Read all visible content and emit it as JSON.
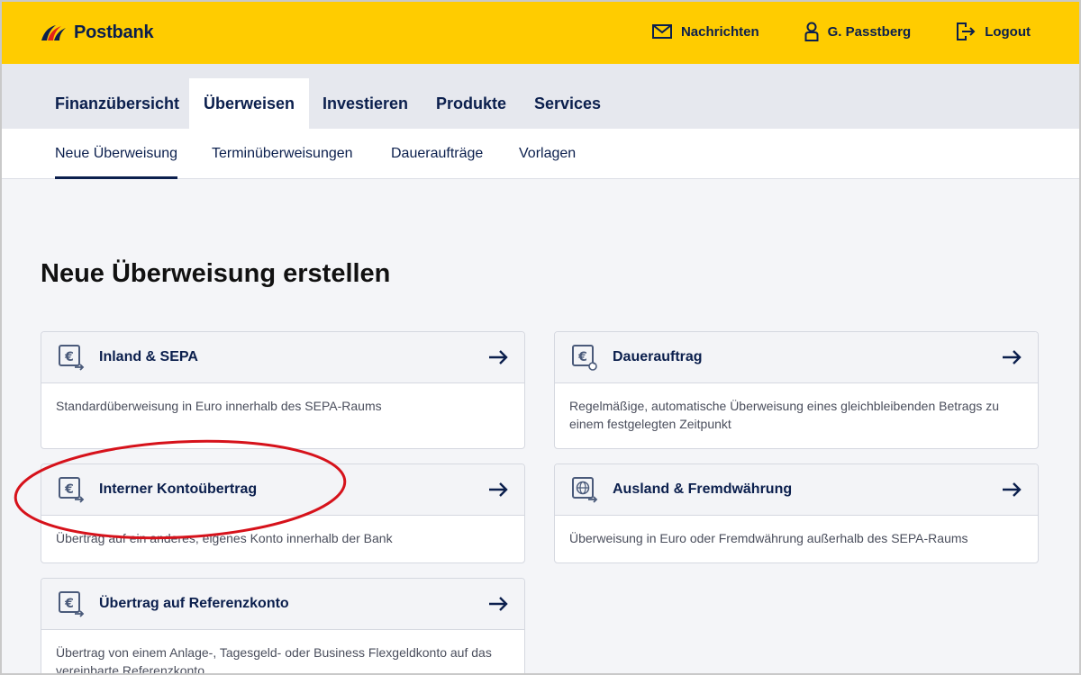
{
  "brand": {
    "name": "Postbank",
    "colors": {
      "yellow": "#ffcc00",
      "navy": "#0b1f4d",
      "highlight": "#d6121b"
    }
  },
  "header": {
    "actions": [
      {
        "label": "Nachrichten",
        "icon": "envelope-icon"
      },
      {
        "label": "G. Passtberg",
        "icon": "user-icon"
      },
      {
        "label": "Logout",
        "icon": "logout-icon"
      }
    ]
  },
  "main_nav": {
    "items": [
      {
        "label": "Finanzübersicht"
      },
      {
        "label": "Überweisen",
        "active": true
      },
      {
        "label": "Investieren"
      },
      {
        "label": "Produkte"
      },
      {
        "label": "Services"
      }
    ]
  },
  "sub_nav": {
    "items": [
      {
        "label": "Neue Überweisung",
        "active": true
      },
      {
        "label": "Terminüberweisungen"
      },
      {
        "label": "Daueraufträge"
      },
      {
        "label": "Vorlagen"
      }
    ]
  },
  "page": {
    "title": "Neue Überweisung erstellen"
  },
  "cards": [
    {
      "title": "Inland & SEPA",
      "icon": "euro-transfer-icon",
      "description": "Standardüberweisung in Euro innerhalb des SEPA-Raums"
    },
    {
      "title": "Dauerauftrag",
      "icon": "euro-recurring-icon",
      "description": "Regelmäßige, automatische Überweisung eines gleichbleibenden Betrags zu einem festgelegten Zeitpunkt"
    },
    {
      "title": "Interner Kontoübertrag",
      "icon": "euro-transfer-icon",
      "description": "Übertrag auf ein anderes, eigenes Konto innerhalb der Bank"
    },
    {
      "title": "Ausland & Fremdwährung",
      "icon": "globe-transfer-icon",
      "description": "Überweisung in Euro oder Fremdwährung außerhalb des SEPA-Raums"
    },
    {
      "title": "Übertrag auf Referenzkonto",
      "icon": "euro-transfer-icon",
      "description": "Übertrag von einem Anlage-, Tagesgeld- oder Business Flexgeldkonto auf das vereinbarte Referenzkonto"
    }
  ]
}
